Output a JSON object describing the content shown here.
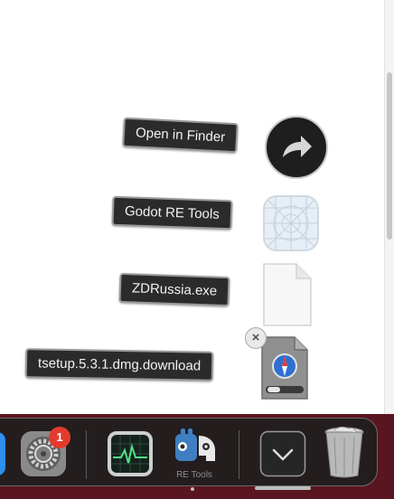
{
  "stack_items": [
    {
      "label": "Open in Finder",
      "icon": "arrow-icon"
    },
    {
      "label": "Godot RE Tools",
      "icon": "app-icon"
    },
    {
      "label": "ZDRussia.exe",
      "icon": "document-icon"
    },
    {
      "label": "tsetup.5.3.1.dmg.download",
      "icon": "download-icon"
    }
  ],
  "close_glyph": "×",
  "dock": {
    "settings_badge": "1",
    "re_tools_caption": "RE Tools",
    "apps": [
      "finder",
      "system-settings",
      "activity-monitor",
      "re-tools",
      "downloads-stack",
      "trash"
    ]
  }
}
